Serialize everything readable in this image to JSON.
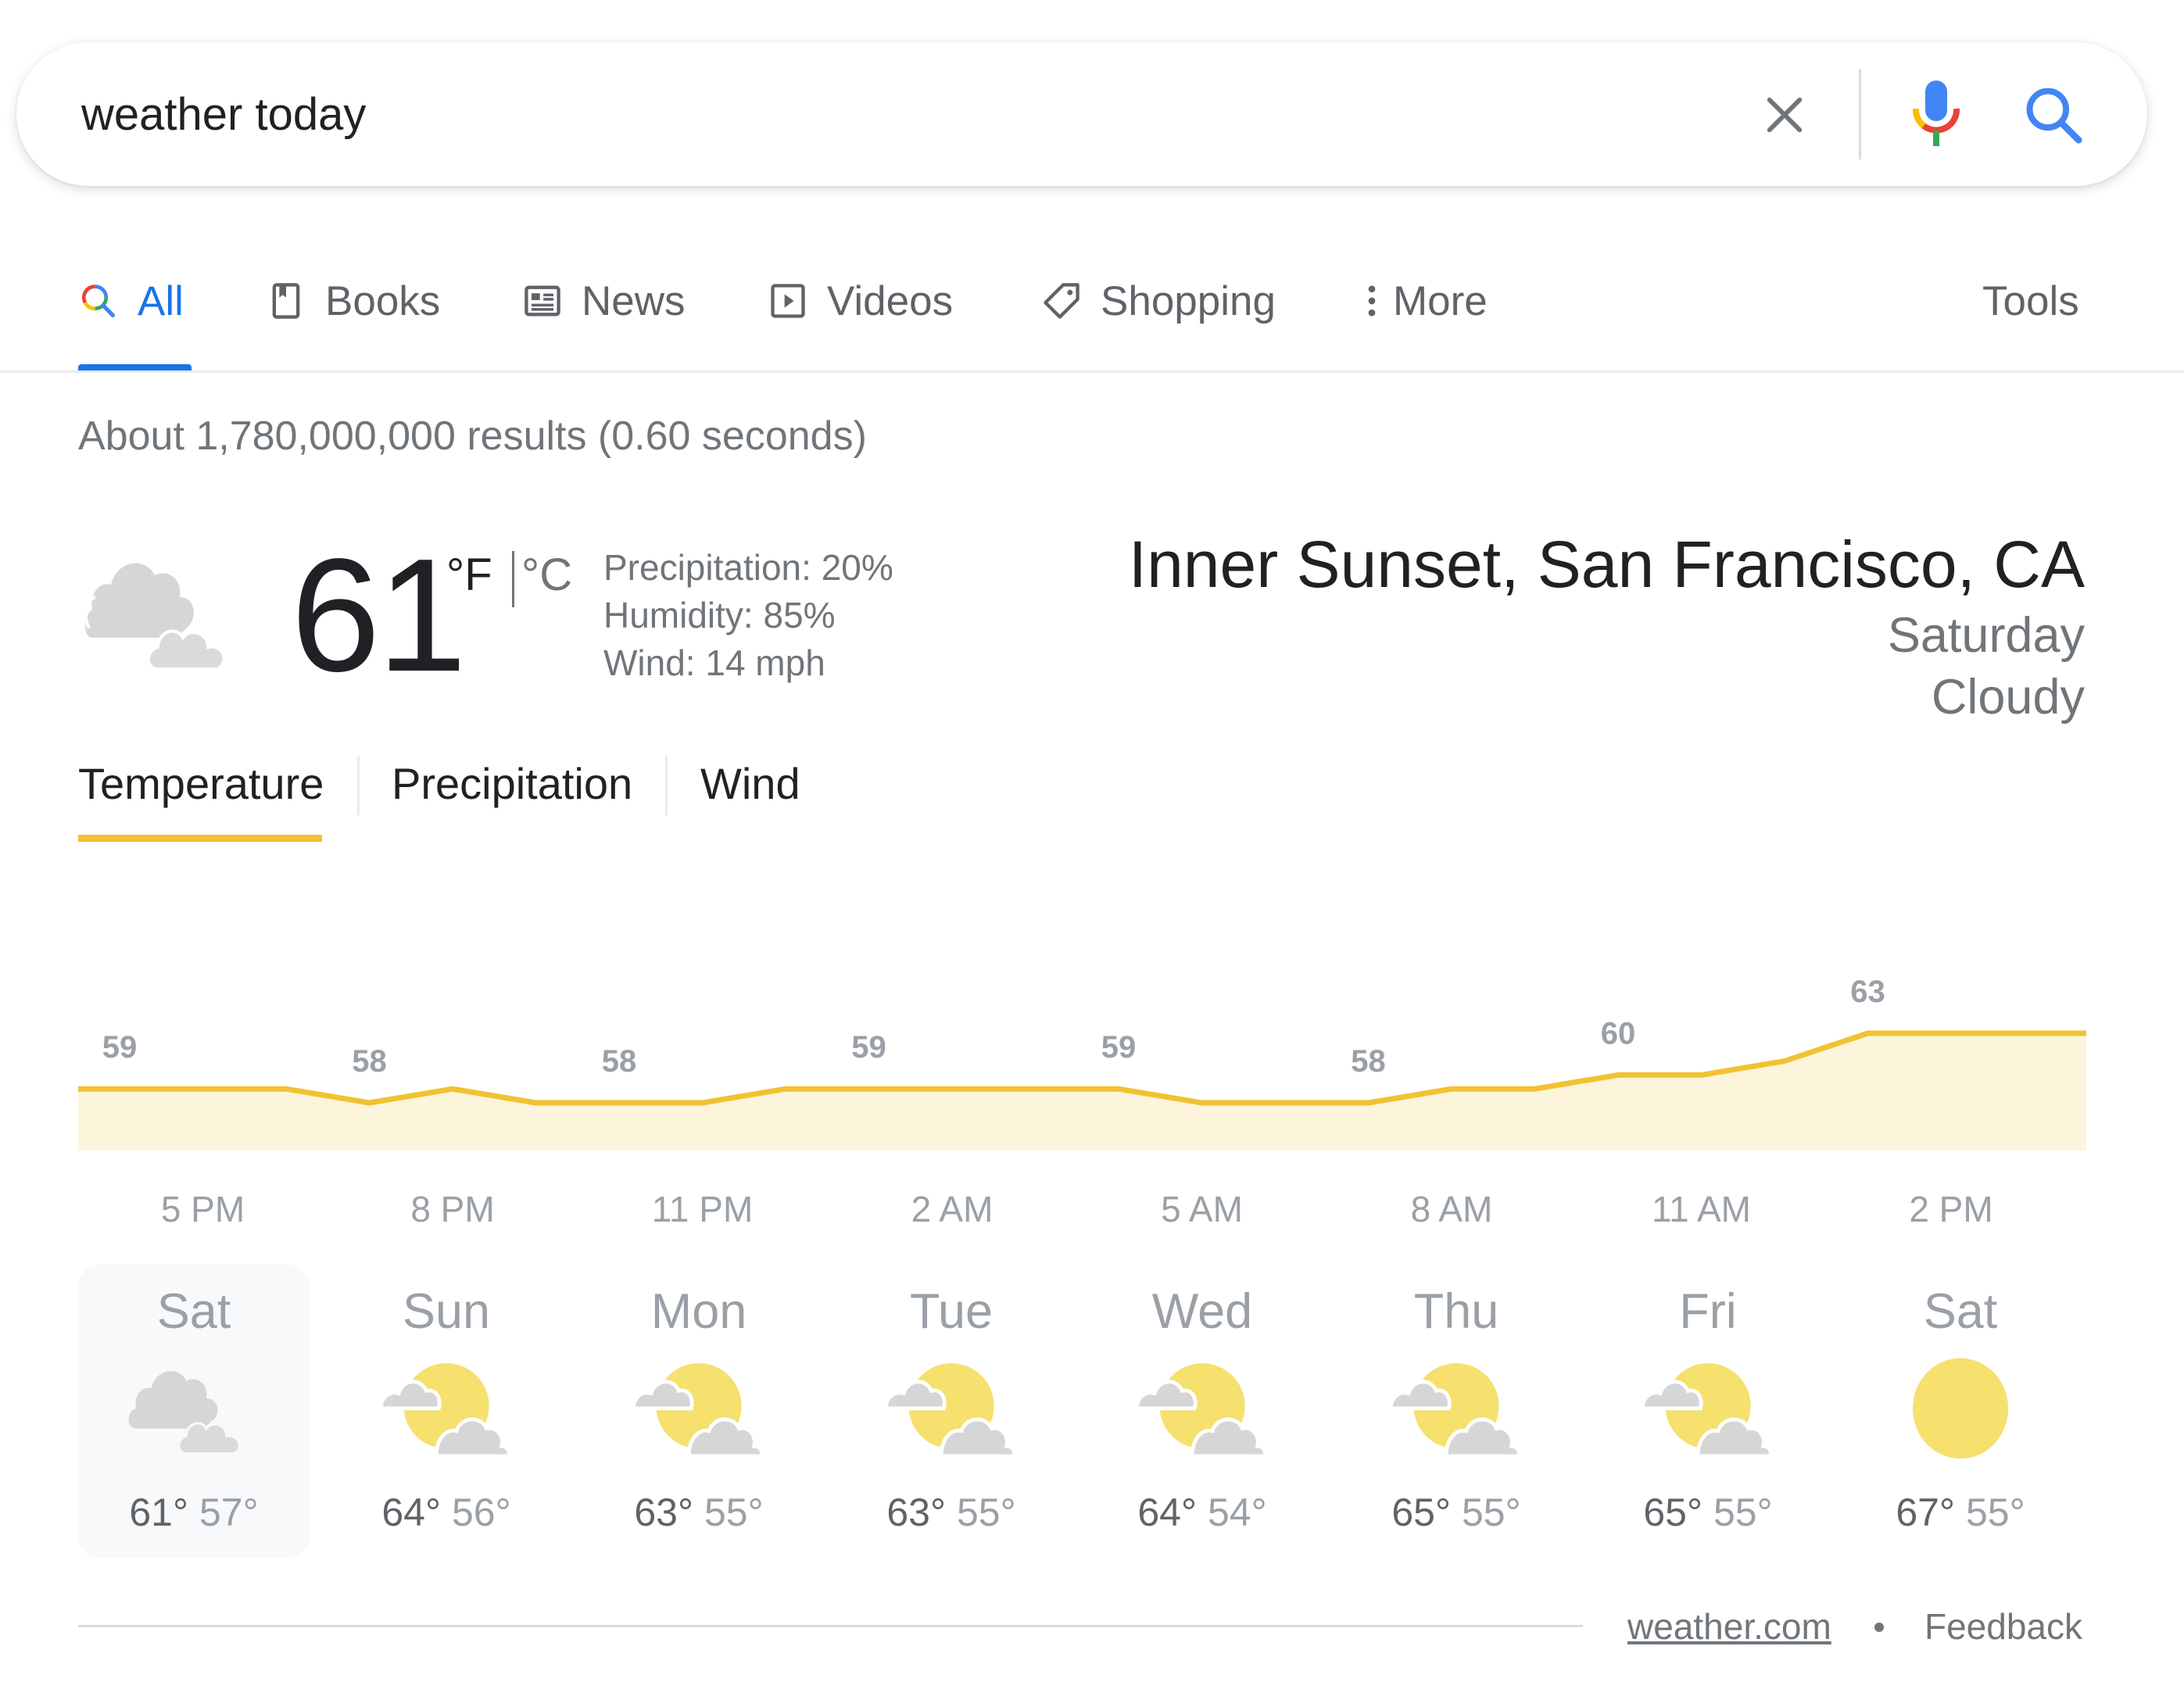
{
  "search": {
    "query": "weather today",
    "clear_label": "Clear",
    "voice_label": "Search by voice",
    "submit_label": "Search"
  },
  "nav": {
    "tabs": [
      {
        "label": "All",
        "icon": "search-icon",
        "active": true
      },
      {
        "label": "Books",
        "icon": "book-icon"
      },
      {
        "label": "News",
        "icon": "newspaper-icon"
      },
      {
        "label": "Videos",
        "icon": "play-icon"
      },
      {
        "label": "Shopping",
        "icon": "tag-icon"
      },
      {
        "label": "More",
        "icon": "more-vertical-icon"
      }
    ],
    "tools_label": "Tools"
  },
  "results_stats": "About 1,780,000,000 results (0.60 seconds)",
  "weather": {
    "current": {
      "icon": "cloudy-icon",
      "temperature": "61",
      "unit_f": "°F",
      "unit_c": "°C",
      "precipitation": "Precipitation: 20%",
      "humidity": "Humidity: 85%",
      "wind": "Wind: 14 mph"
    },
    "location": "Inner Sunset, San Francisco, CA",
    "day": "Saturday",
    "condition": "Cloudy",
    "subtabs": [
      {
        "label": "Temperature",
        "active": true
      },
      {
        "label": "Precipitation"
      },
      {
        "label": "Wind"
      }
    ],
    "colors": {
      "line": "#f1c232",
      "fill": "#fcf5dc",
      "tab_underline": "#f1c232",
      "accent_blue": "#1a73e8"
    },
    "forecast": [
      {
        "day": "Sat",
        "icon": "cloudy-icon",
        "high": "61°",
        "low": "57°",
        "selected": true
      },
      {
        "day": "Sun",
        "icon": "partly-sunny-icon",
        "high": "64°",
        "low": "56°"
      },
      {
        "day": "Mon",
        "icon": "partly-sunny-icon",
        "high": "63°",
        "low": "55°"
      },
      {
        "day": "Tue",
        "icon": "partly-sunny-icon",
        "high": "63°",
        "low": "55°"
      },
      {
        "day": "Wed",
        "icon": "partly-sunny-icon",
        "high": "64°",
        "low": "54°"
      },
      {
        "day": "Thu",
        "icon": "partly-sunny-icon",
        "high": "65°",
        "low": "55°"
      },
      {
        "day": "Fri",
        "icon": "partly-sunny-icon",
        "high": "65°",
        "low": "55°"
      },
      {
        "day": "Sat",
        "icon": "sunny-icon",
        "high": "67°",
        "low": "55°"
      }
    ],
    "footer": {
      "source": "weather.com",
      "feedback": "Feedback"
    }
  },
  "chart_data": {
    "type": "area",
    "title": "Temperature",
    "xlabel": "",
    "ylabel": "°F",
    "x_tick_labels": [
      "5 PM",
      "8 PM",
      "11 PM",
      "2 AM",
      "5 AM",
      "8 AM",
      "11 AM",
      "2 PM"
    ],
    "hourly_values": [
      59,
      59,
      59,
      58,
      59,
      58,
      58,
      58,
      59,
      59,
      59,
      59,
      59,
      58,
      58,
      58,
      59,
      59,
      60,
      60,
      61,
      63,
      63,
      63
    ],
    "data_label_every": 3,
    "data_labels": [
      "59",
      "58",
      "58",
      "59",
      "59",
      "58",
      "60",
      "63"
    ],
    "ylim": [
      54,
      66
    ],
    "grid": false,
    "legend": "none"
  }
}
